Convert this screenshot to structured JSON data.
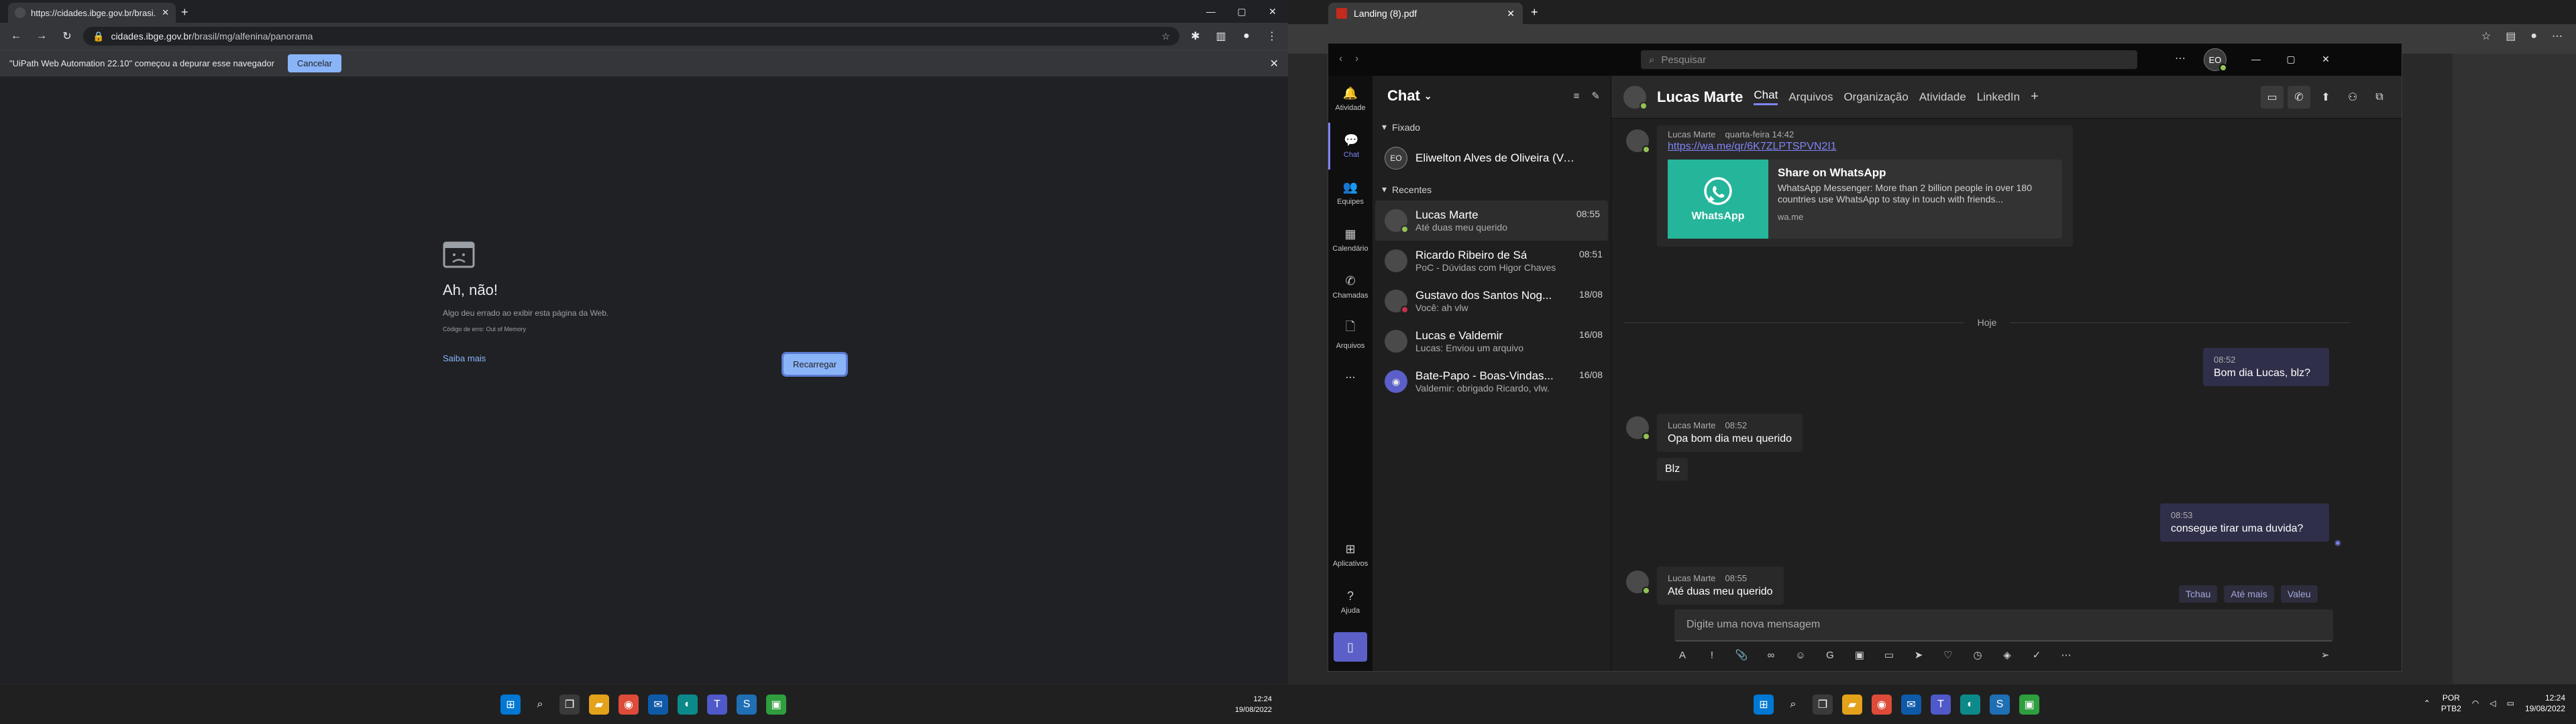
{
  "left_monitor": {
    "tab": {
      "title": "https://cidades.ibge.gov.br/brasi..."
    },
    "window_controls": [
      "—",
      "▢",
      "✕"
    ],
    "address": {
      "domain": "cidades.ibge.gov.br",
      "path": "/brasil/mg/alfenina/panorama"
    },
    "infobar": {
      "text": "\"UiPath Web Automation 22.10\" começou a depurar esse navegador",
      "cancel": "Cancelar"
    },
    "error": {
      "title": "Ah, não!",
      "subtitle": "Algo deu errado ao exibir esta página da Web.",
      "code": "Código de erro: Out of Memory",
      "learn_more": "Saiba mais",
      "reload": "Recarregar"
    },
    "clock": {
      "time": "12:24",
      "date": "19/08/2022"
    }
  },
  "right_monitor": {
    "edge_tab": {
      "title": "Landing (8).pdf"
    },
    "teams": {
      "search_placeholder": "Pesquisar",
      "user_initials": "EO",
      "rail": [
        {
          "label": "Atividade",
          "icon": "bell-icon"
        },
        {
          "label": "Chat",
          "icon": "chat-icon"
        },
        {
          "label": "Equipes",
          "icon": "teams-icon"
        },
        {
          "label": "Calendário",
          "icon": "calendar-icon"
        },
        {
          "label": "Chamadas",
          "icon": "phone-icon"
        },
        {
          "label": "Arquivos",
          "icon": "file-icon"
        },
        {
          "label": "...",
          "icon": "more-icon"
        },
        {
          "label": "Aplicativos",
          "icon": "apps-icon"
        },
        {
          "label": "Ajuda",
          "icon": "help-icon"
        }
      ],
      "list_title": "Chat",
      "pinned_label": "Fixado",
      "recent_label": "Recentes",
      "pinned": [
        {
          "name": "Eliwelton Alves de Oliveira (Vo...",
          "initials": "EO"
        }
      ],
      "recent": [
        {
          "name": "Lucas Marte",
          "time": "08:55",
          "preview": "Até duas meu querido"
        },
        {
          "name": "Ricardo Ribeiro de Sá",
          "time": "08:51",
          "preview": "PoC - Dúvidas com Higor Chaves"
        },
        {
          "name": "Gustavo dos Santos Nog...",
          "time": "18/08",
          "preview": "Você: ah vlw"
        },
        {
          "name": "Lucas e Valdemir",
          "time": "16/08",
          "preview": "Lucas: Enviou um arquivo"
        },
        {
          "name": "Bate-Papo - Boas-Vindas...",
          "time": "16/08",
          "preview": "Valdemir: obrigado Ricardo, vlw."
        }
      ],
      "conversation": {
        "name": "Lucas Marte",
        "tabs": [
          "Chat",
          "Arquivos",
          "Organização",
          "Atividade",
          "LinkedIn",
          "+"
        ],
        "first_msg": {
          "sender": "Lucas Marte",
          "time": "quarta-feira 14:42",
          "link": "https://wa.me/qr/6K7ZLPTSPVN2I1"
        },
        "card": {
          "title": "Share on WhatsApp",
          "desc": "WhatsApp Messenger: More than 2 billion people in over 180 countries use WhatsApp to stay in touch with friends...",
          "domain": "wa.me",
          "logo_text": "WhatsApp"
        },
        "divider": "Hoje",
        "out1": {
          "time": "08:52",
          "text": "Bom dia Lucas, blz?"
        },
        "in1": {
          "sender": "Lucas Marte",
          "time": "08:52",
          "text": "Opa bom dia meu querido"
        },
        "in1b": {
          "text": "Blz"
        },
        "out2": {
          "time": "08:53",
          "text": "consegue tirar uma duvida?"
        },
        "in2": {
          "sender": "Lucas Marte",
          "time": "08:55",
          "text": "Até duas meu querido"
        },
        "quick_replies": [
          "Tchau",
          "Até mais",
          "Valeu"
        ],
        "compose_placeholder": "Digite uma nova mensagem"
      }
    },
    "tray": {
      "lang1": "POR",
      "lang2": "PTB2",
      "time": "12:24",
      "date": "19/08/2022"
    }
  },
  "colors": {
    "accent": "#7f85f5",
    "presence": "#92c353",
    "whatsapp": "#25b59a"
  }
}
